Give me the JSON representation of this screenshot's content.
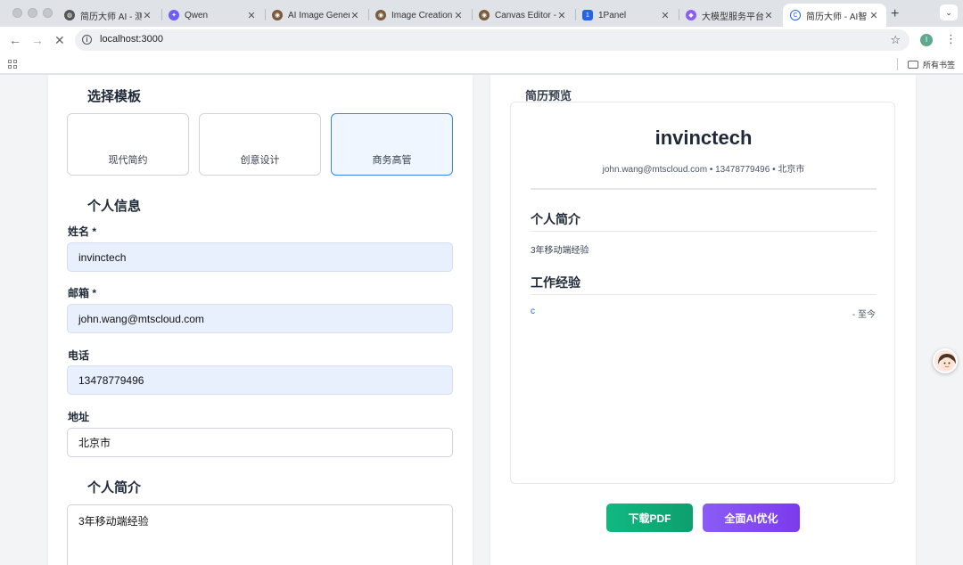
{
  "browser": {
    "tabs": [
      {
        "title": "简历大师 AI - 测",
        "active": false
      },
      {
        "title": "Qwen",
        "active": false
      },
      {
        "title": "AI Image Genera",
        "active": false
      },
      {
        "title": "Image Creation",
        "active": false
      },
      {
        "title": "Canvas Editor -",
        "active": false
      },
      {
        "title": "1Panel",
        "active": false
      },
      {
        "title": "大模型服务平台",
        "active": false
      },
      {
        "title": "简历大师 - AI智",
        "active": true
      }
    ],
    "address": "localhost:3000",
    "profile_initial": "I",
    "bookmarks_folder": "所有书签"
  },
  "form": {
    "template_heading": "选择模板",
    "templates": [
      {
        "label": "现代简约",
        "selected": false
      },
      {
        "label": "创意设计",
        "selected": false
      },
      {
        "label": "商务高管",
        "selected": true
      }
    ],
    "personal_heading": "个人信息",
    "name_label": "姓名 *",
    "name_value": "invinctech",
    "email_label": "邮箱 *",
    "email_value": "john.wang@mtscloud.com",
    "phone_label": "电话",
    "phone_value": "13478779496",
    "address_label": "地址",
    "address_value": "北京市",
    "summary_heading": "个人简介",
    "summary_value": "3年移动端经验"
  },
  "preview": {
    "heading": "简历预览",
    "name": "invinctech",
    "contact": "john.wang@mtscloud.com • 13478779496 • 北京市",
    "summary_heading": "个人简介",
    "summary_text": "3年移动端经验",
    "experience_heading": "工作经验",
    "experience_company": "c",
    "experience_date": "- 至今"
  },
  "actions": {
    "download_pdf": "下载PDF",
    "ai_optimize": "全面AI优化"
  },
  "colors": {
    "accent_blue": "#3b82f6",
    "pdf_green": "#10b981",
    "ai_purple": "#8b5cf6"
  }
}
